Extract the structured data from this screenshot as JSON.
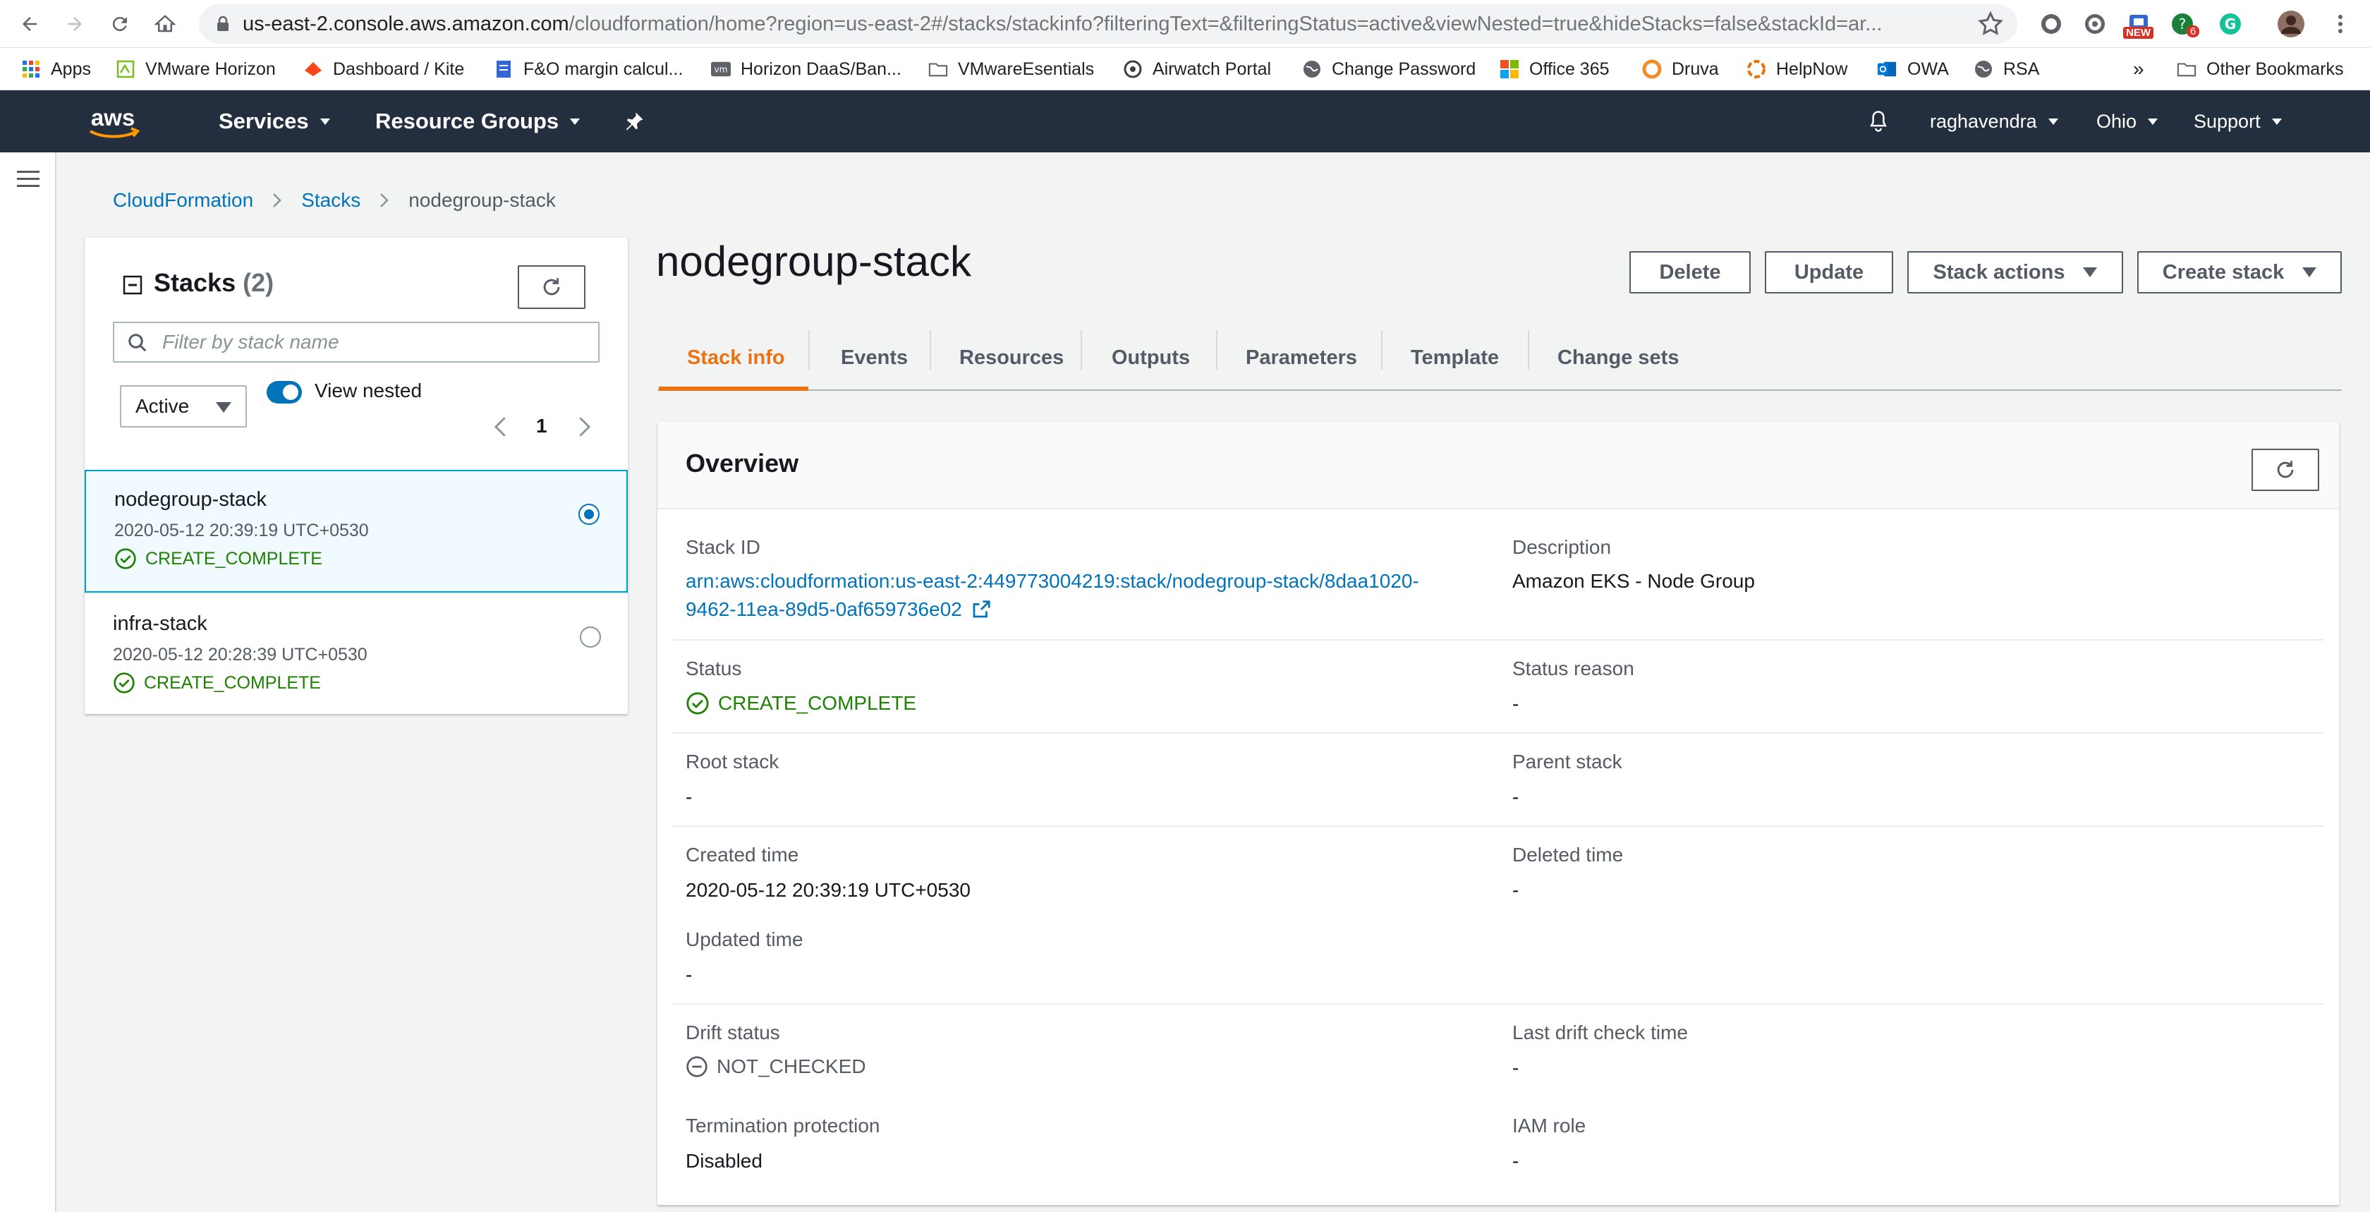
{
  "browser": {
    "url_domain": "us-east-2.console.aws.amazon.com",
    "url_path": "/cloudformation/home?region=us-east-2#/stacks/stackinfo?filteringText=&filteringStatus=active&viewNested=true&hideStacks=false&stackId=ar...",
    "ext_new_badge": "NEW",
    "ext_count_badge": "6"
  },
  "bookmarks": {
    "items": [
      "Apps",
      "VMware Horizon",
      "Dashboard / Kite",
      "F&O margin calcul...",
      "Horizon DaaS/Ban...",
      "VMwareEsentials",
      "Airwatch Portal",
      "Change Password",
      "Office 365",
      "Druva",
      "HelpNow",
      "OWA",
      "RSA"
    ],
    "more": "»",
    "other": "Other Bookmarks"
  },
  "aws_nav": {
    "logo": "aws",
    "services": "Services",
    "resource_groups": "Resource Groups",
    "user": "raghavendra",
    "region": "Ohio",
    "support": "Support"
  },
  "breadcrumb": {
    "root": "CloudFormation",
    "stacks": "Stacks",
    "current": "nodegroup-stack"
  },
  "stacks_panel": {
    "title": "Stacks",
    "count": "(2)",
    "filter_placeholder": "Filter by stack name",
    "status_filter": "Active",
    "view_nested": "View nested",
    "page": "1",
    "stacks": [
      {
        "name": "nodegroup-stack",
        "time": "2020-05-12 20:39:19 UTC+0530",
        "status": "CREATE_COMPLETE"
      },
      {
        "name": "infra-stack",
        "time": "2020-05-12 20:28:39 UTC+0530",
        "status": "CREATE_COMPLETE"
      }
    ]
  },
  "main": {
    "title": "nodegroup-stack",
    "buttons": {
      "delete": "Delete",
      "update": "Update",
      "stack_actions": "Stack actions",
      "create_stack": "Create stack"
    },
    "tabs": [
      "Stack info",
      "Events",
      "Resources",
      "Outputs",
      "Parameters",
      "Template",
      "Change sets"
    ]
  },
  "overview": {
    "title": "Overview",
    "stack_id_label": "Stack ID",
    "stack_id_line1": "arn:aws:cloudformation:us-east-2:449773004219:stack/nodegroup-stack/8daa1020-",
    "stack_id_line2": "9462-11ea-89d5-0af659736e02",
    "description_label": "Description",
    "description": "Amazon EKS - Node Group",
    "status_label": "Status",
    "status": "CREATE_COMPLETE",
    "status_reason_label": "Status reason",
    "status_reason": "-",
    "root_stack_label": "Root stack",
    "root_stack": "-",
    "parent_stack_label": "Parent stack",
    "parent_stack": "-",
    "created_label": "Created time",
    "created": "2020-05-12 20:39:19 UTC+0530",
    "deleted_label": "Deleted time",
    "deleted": "-",
    "updated_label": "Updated time",
    "updated": "-",
    "drift_label": "Drift status",
    "drift": "NOT_CHECKED",
    "last_drift_label": "Last drift check time",
    "last_drift": "-",
    "termination_label": "Termination protection",
    "termination": "Disabled",
    "iam_label": "IAM role",
    "iam": "-"
  },
  "colors": {
    "aws_nav": "#232f3e",
    "link": "#0073bb",
    "accent": "#ec7211",
    "success": "#1d8102"
  }
}
